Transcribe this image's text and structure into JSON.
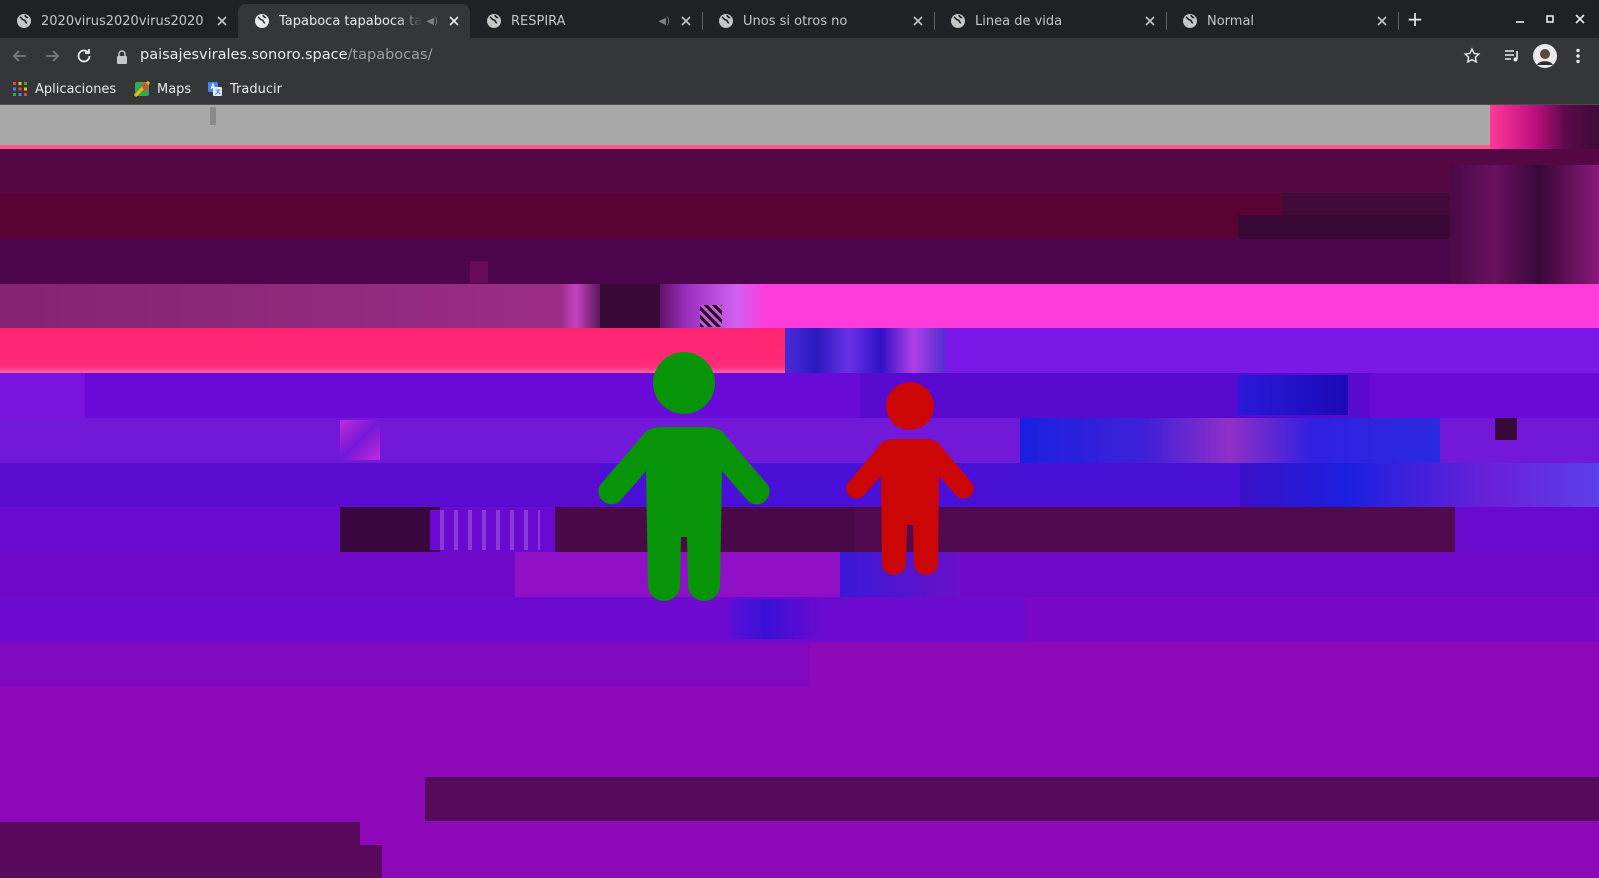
{
  "browser": {
    "tabs": [
      {
        "title": "2020virus2020virus2020",
        "active": false,
        "audio": false
      },
      {
        "title": "Tapaboca tapaboca tapaboca",
        "active": true,
        "audio": true
      },
      {
        "title": "RESPIRA",
        "active": false,
        "audio": true
      },
      {
        "title": "Unos si otros no",
        "active": false,
        "audio": false
      },
      {
        "title": "Linea de vida",
        "active": false,
        "audio": false
      },
      {
        "title": "Normal",
        "active": false,
        "audio": false
      }
    ],
    "url": {
      "host": "paisajesvirales.sonoro.space",
      "path": "/tapabocas/"
    },
    "bookmarks": [
      {
        "label": "Aplicaciones",
        "icon": "apps-grid-icon"
      },
      {
        "label": "Maps",
        "icon": "maps-icon"
      },
      {
        "label": "Traducir",
        "icon": "translate-icon"
      }
    ]
  },
  "page": {
    "figures": [
      {
        "name": "adult-figure",
        "color": "#089408"
      },
      {
        "name": "child-figure",
        "color": "#cc0606"
      }
    ],
    "colors": {
      "gray_strip": "#a9a9a9",
      "maroon": "#550844",
      "pink": "#ff3adb",
      "coral": "#ff2470",
      "violet": "#6a02d8",
      "purple": "#8c08b8"
    }
  }
}
